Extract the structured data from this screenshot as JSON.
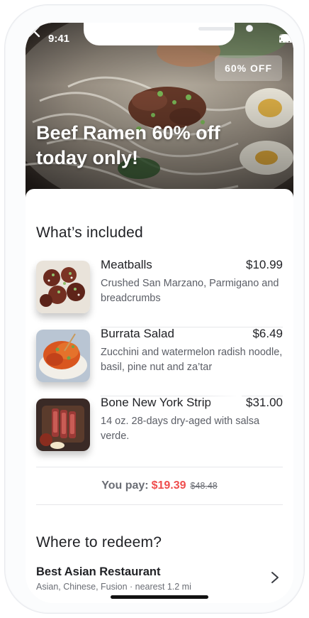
{
  "status_bar": {
    "time": "9:41"
  },
  "hero": {
    "badge": "60% OFF",
    "title": "Beef Ramen 60% off today only!"
  },
  "included": {
    "title": "What’s included",
    "items": [
      {
        "name": "Meatballs",
        "price": "$10.99",
        "description": "Crushed San Marzano, Parmigano and breadcrumbs"
      },
      {
        "name": "Burrata Salad",
        "price": "$6.49",
        "description": "Zucchini and watermelon radish noodle, basil, pine nut and za’tar"
      },
      {
        "name": "Bone New York Strip",
        "price": "$31.00",
        "description": "14 oz. 28-days dry-aged with salsa verde."
      }
    ]
  },
  "payment": {
    "label": "You pay:",
    "amount": "$19.39",
    "original": "$48.48"
  },
  "redeem": {
    "title": "Where to redeem?",
    "restaurant_name": "Best Asian Restaurant",
    "restaurant_meta": "Asian, Chinese, Fusion · nearest 1.2 mi"
  },
  "colors": {
    "accent_price": "#ef4d4d",
    "text_primary": "#1f2024",
    "text_secondary": "#5b5e66"
  },
  "icons": [
    "close-icon",
    "signal-icon",
    "wifi-icon",
    "battery-icon",
    "chevron-right-icon"
  ]
}
